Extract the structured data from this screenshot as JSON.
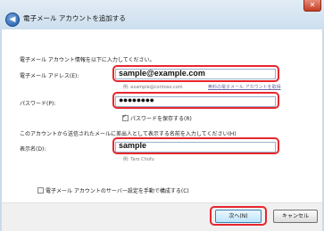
{
  "window": {
    "title": "電子メール アカウントを追加する",
    "close_glyph": "✕",
    "back_glyph": "◀"
  },
  "form": {
    "instructions": "電子メール アカウント情報を以下に入力してください。",
    "email_label": "電子メール アドレス(E):",
    "email_value": "sample@example.com",
    "email_hint": "例: example@contoso.com",
    "email_link": "無料の電子メール アカウントを取得",
    "password_label": "パスワード(P):",
    "password_value": "●●●●●●●●",
    "remember_label": "パスワードを保存する(R)",
    "remember_checked": true,
    "display_intro": "このアカウントから送信されたメールに差出人として表示する名前を入力してください(H)",
    "display_label": "表示名(D):",
    "display_value": "sample",
    "display_hint": "例: Taro Chofu",
    "manual_label": "電子メール アカウントのサーバー設定を手動で構成する(C)",
    "manual_checked": false
  },
  "footer": {
    "next_label": "次へ(N)",
    "cancel_label": "キャンセル"
  },
  "colors": {
    "highlight": "#e8262e",
    "window_frame": "#c9dbea"
  }
}
